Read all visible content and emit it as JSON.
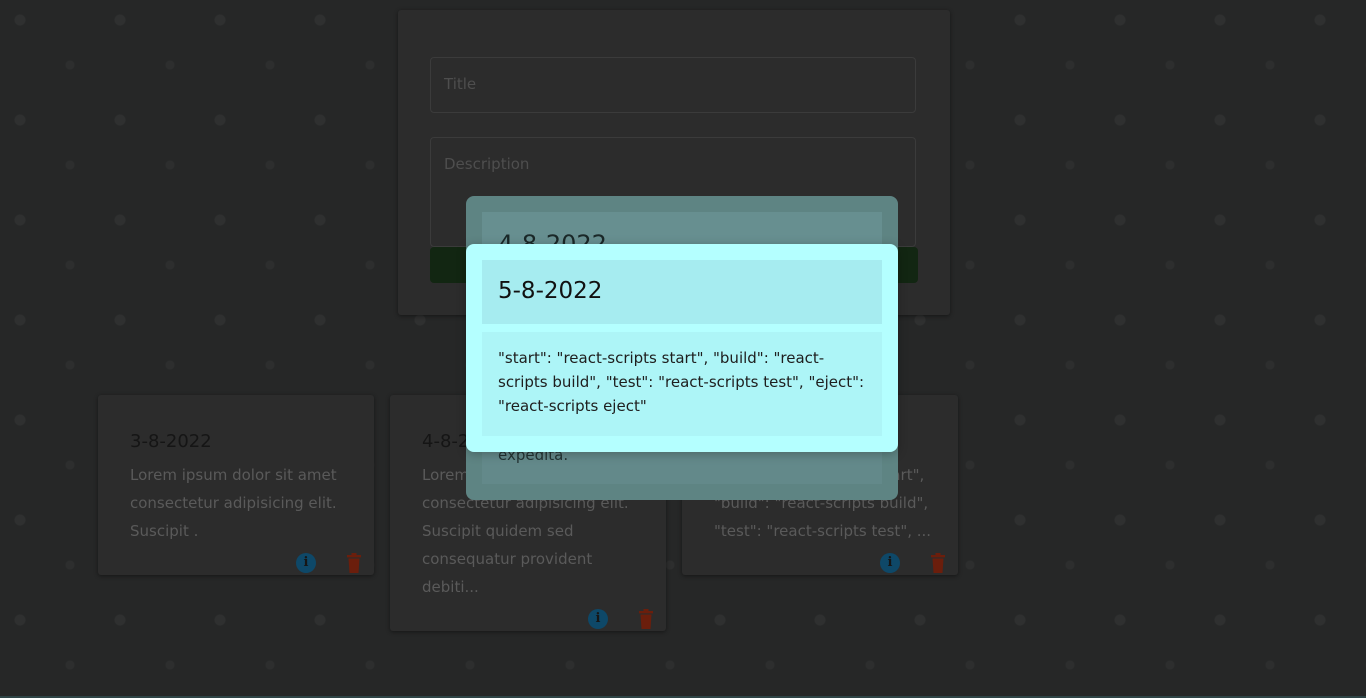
{
  "form": {
    "title_placeholder": "Title",
    "description_placeholder": "Description"
  },
  "notes": [
    {
      "date": "3-8-2022",
      "text": "Lorem ipsum dolor sit amet consectetur adipisicing elit. Suscipit ."
    },
    {
      "date": "4-8-2022",
      "text": "Lorem ipsum dolor sit amet consectetur adipisicing elit. Suscipit quidem sed consequatur provident debiti..."
    },
    {
      "date": "5-8-2022",
      "text_lines": [
        "\"start\": \"react-scripts start\",",
        "\"build\": \"react-scripts build\",",
        "\"test\": \"react-scripts test\", ..."
      ]
    }
  ],
  "back_modal": {
    "date": "4-8-2022",
    "tail_text": "expedita."
  },
  "front_modal": {
    "date": "5-8-2022",
    "description": "\"start\": \"react-scripts start\", \"build\": \"react-scripts build\", \"test\": \"react-scripts test\", \"eject\": \"react-scripts eject\""
  },
  "icons": {
    "info": "info-icon",
    "delete": "trash-icon"
  },
  "colors": {
    "modal_background": "#b4ffff",
    "modal_header": "#a6ecf0",
    "info_icon": "#0e4868",
    "delete_icon": "#6b1e0c",
    "backdrop": "#262727"
  }
}
